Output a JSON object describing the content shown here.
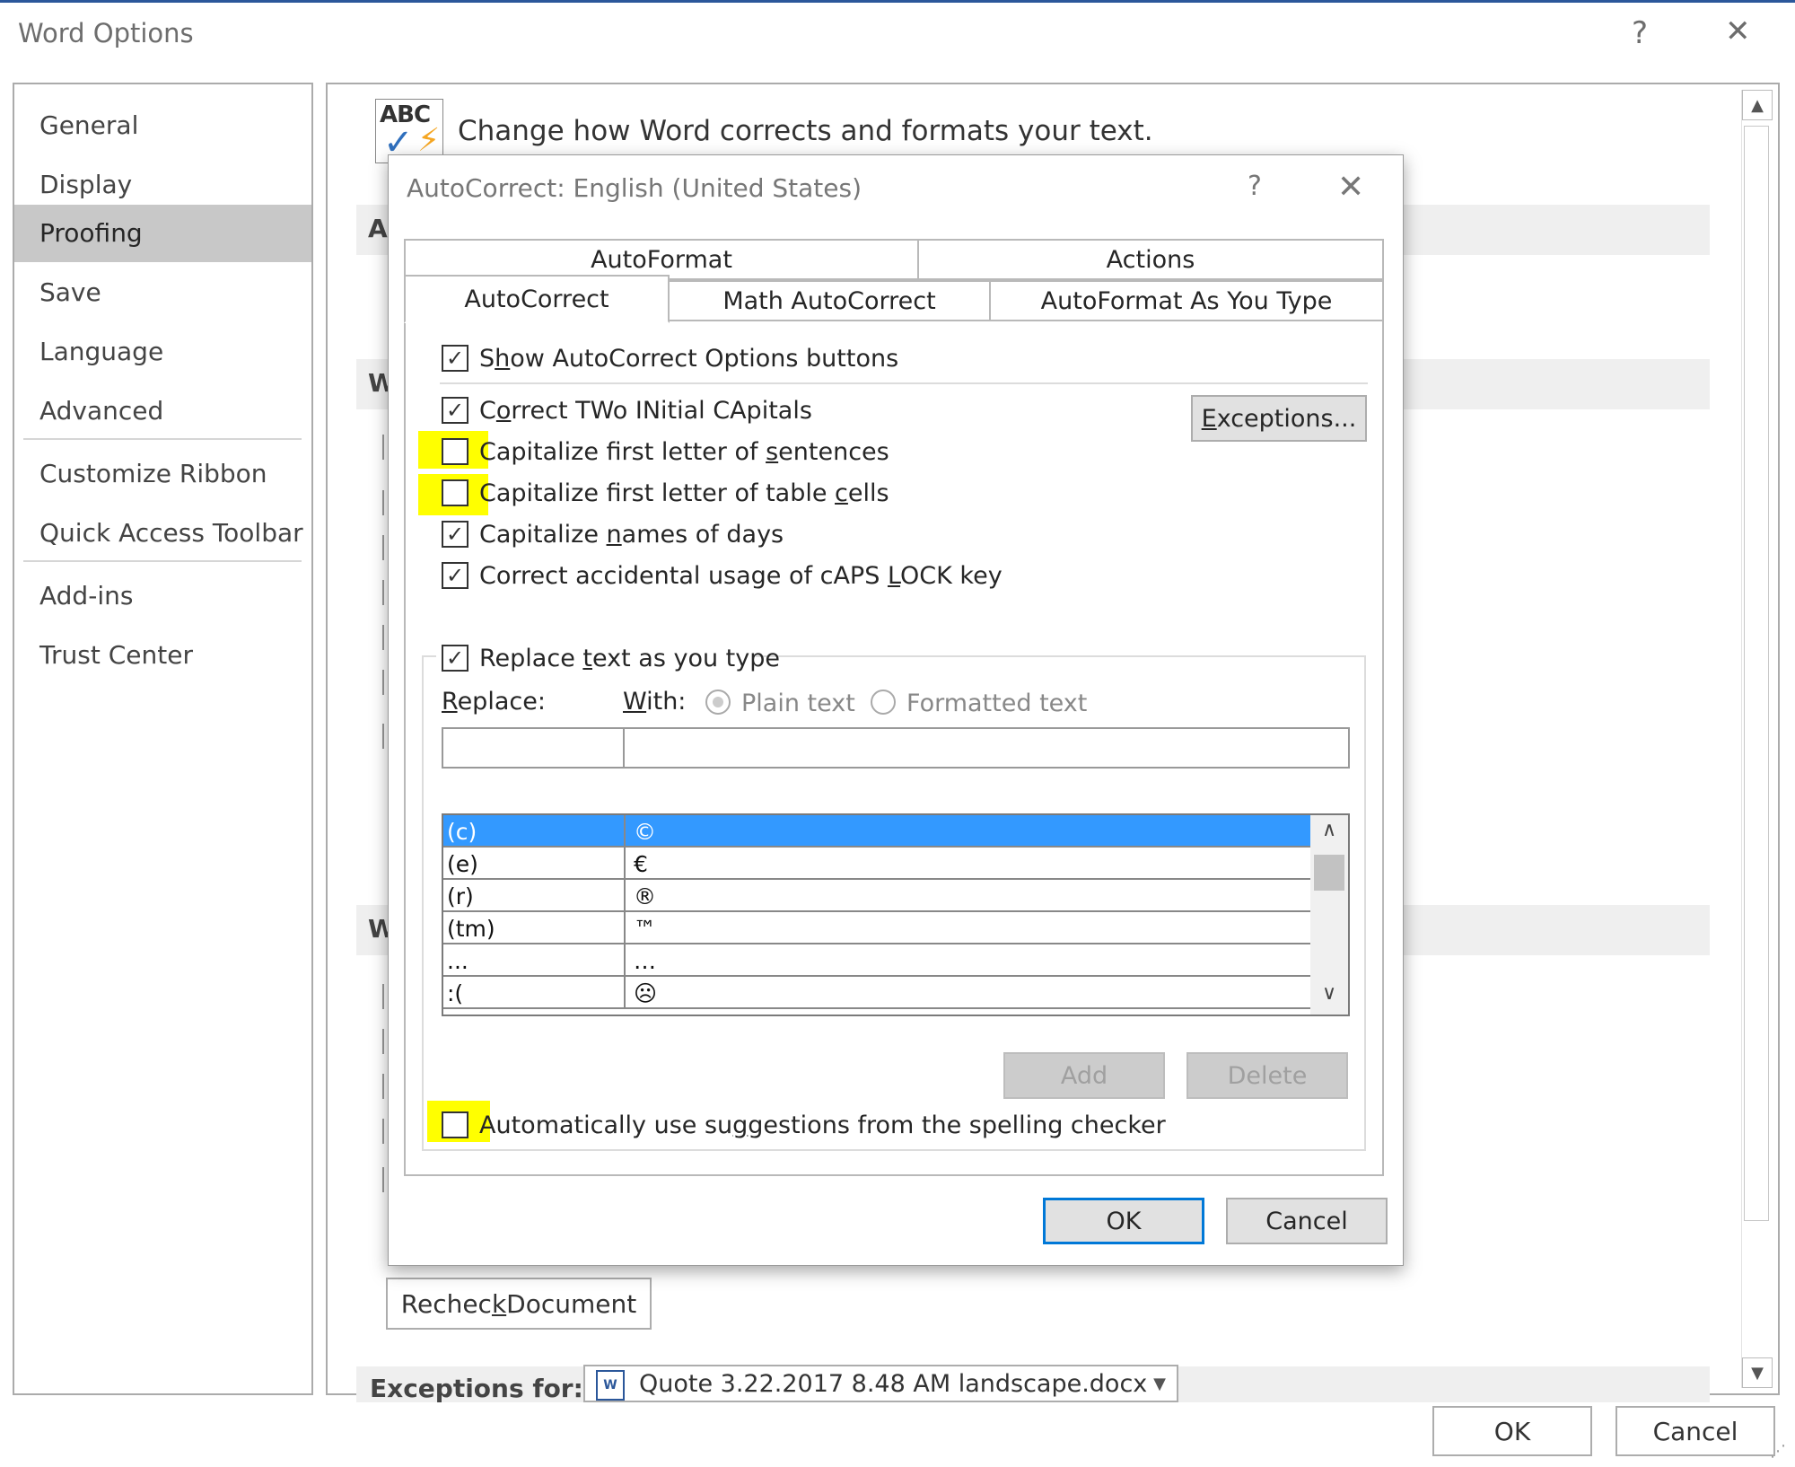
{
  "outer": {
    "title": "Word Options",
    "help": "?",
    "close": "✕",
    "nav": [
      {
        "label": "General"
      },
      {
        "label": "Display"
      },
      {
        "label": "Proofing"
      },
      {
        "label": "Save"
      },
      {
        "label": "Language"
      },
      {
        "label": "Advanced"
      },
      {
        "label": "Customize Ribbon"
      },
      {
        "label": "Quick Access Toolbar"
      },
      {
        "label": "Add-ins"
      },
      {
        "label": "Trust Center"
      }
    ],
    "selected_nav": "Proofing",
    "panel": {
      "icon_text": "ABC",
      "heading": "Change how Word corrects and formats your text.",
      "section_letters": [
        "A",
        "W",
        "W"
      ],
      "recheck_label": "Recheck Document",
      "recheck_underline": "k",
      "exceptions_label": "Exceptions for:",
      "exceptions_value": "Quote 3.22.2017 8.48 AM landscape.docx",
      "exceptions_doc_icon": "W"
    },
    "ok": "OK",
    "cancel": "Cancel"
  },
  "dialog": {
    "title": "AutoCorrect: English (United States)",
    "help": "?",
    "close": "✕",
    "tabs_back": [
      "AutoFormat",
      "Actions"
    ],
    "tabs_front": [
      "AutoCorrect",
      "Math AutoCorrect",
      "AutoFormat As You Type"
    ],
    "active_tab": "AutoCorrect",
    "options": {
      "show_buttons": {
        "pre": "S",
        "u": "h",
        "post": "ow AutoCorrect Options buttons",
        "checked": true
      },
      "two_initial": {
        "pre": "C",
        "u": "o",
        "post": "rrect TWo INitial CApitals",
        "checked": true
      },
      "cap_sentences": {
        "pre": "Capitalize first letter of ",
        "u": "s",
        "post": "entences",
        "checked": false
      },
      "cap_table": {
        "pre": "Capitalize first letter of table ",
        "u": "c",
        "post": "ells",
        "checked": false
      },
      "cap_days": {
        "pre": "Capitalize ",
        "u": "n",
        "post": "ames of days",
        "checked": true
      },
      "caps_lock": {
        "pre": "Correct accidental usage of cAPS ",
        "u": "L",
        "post": "OCK key",
        "checked": true
      }
    },
    "exceptions_button": {
      "u": "E",
      "post": "xceptions..."
    },
    "replace_text": {
      "pre": "Replace ",
      "u": "t",
      "post": "ext as you type",
      "checked": true
    },
    "replace_label": {
      "u": "R",
      "post": "eplace:"
    },
    "with_label": {
      "u": "W",
      "post": "ith:"
    },
    "plain_text": "Plain text",
    "formatted_text": "Formatted text",
    "replace_value": "",
    "with_value": "",
    "entries": [
      {
        "from": "(c)",
        "to": "©"
      },
      {
        "from": "(e)",
        "to": "€"
      },
      {
        "from": "(r)",
        "to": "®"
      },
      {
        "from": "(tm)",
        "to": "™"
      },
      {
        "from": "...",
        "to": "…"
      },
      {
        "from": ":(",
        "to": "☹"
      }
    ],
    "add": "Add",
    "delete": "Delete",
    "auto_suggest": {
      "pre": "Automatically use su",
      "u": "g",
      "post": "gestions from the spelling checker",
      "checked": false
    },
    "ok": "OK",
    "cancel": "Cancel"
  },
  "colors": {
    "highlight": "#ffff00",
    "selection": "#3399ff",
    "accent": "#0078d7"
  },
  "icons": {
    "up_arrow": "▲",
    "down_arrow": "▼",
    "chevron_up": "∧",
    "chevron_down": "∨",
    "check": "✓"
  }
}
